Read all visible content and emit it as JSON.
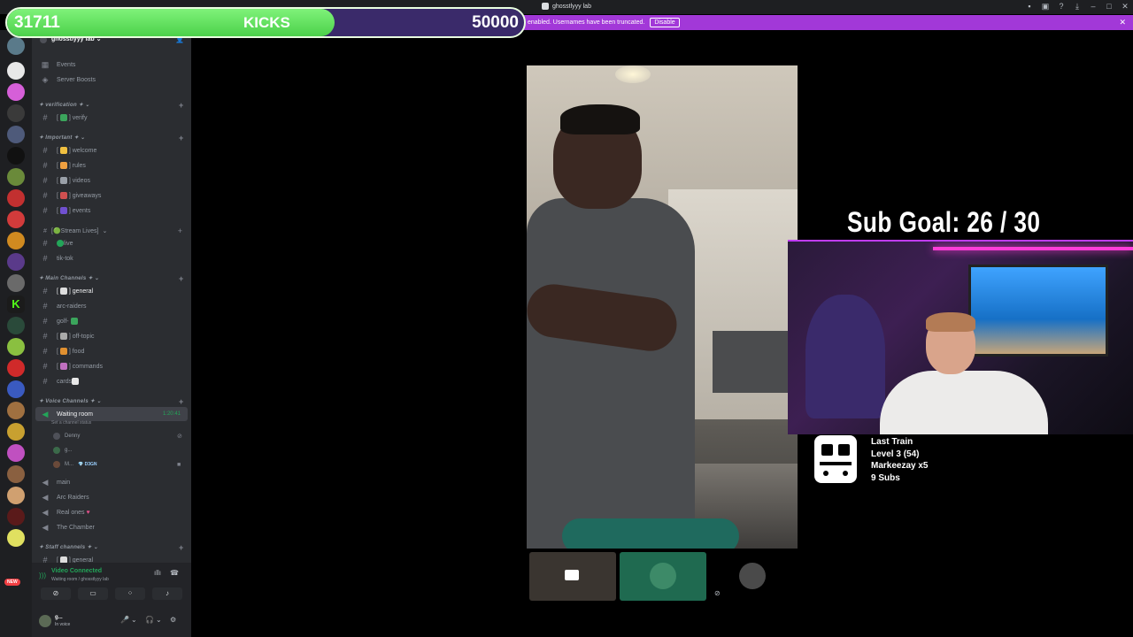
{
  "window": {
    "title": "ghosstlyyy lab"
  },
  "notice": {
    "text": "enabled. Usernames have been truncated.",
    "button": "Disable",
    "close": "✕"
  },
  "kicks": {
    "current": "31711",
    "label": "KICKS",
    "goal": "50000",
    "progress": 0.634
  },
  "server": {
    "name": "ghosstlyyy lab"
  },
  "menu": {
    "events": "Events",
    "boosts": "Server Boosts"
  },
  "categories": {
    "verification": "✦ verification ✦",
    "important": "✦ Important ✦",
    "stream": "[🟢Stream Lives]",
    "main": "✦ Main Channels ✦",
    "voice": "✦ Voice Channels ✦",
    "staff": "✦ Staff channels ✦"
  },
  "channels": {
    "verify": "verify",
    "welcome": "welcome",
    "rules": "rules",
    "videos": "videos",
    "giveaways": "giveaways",
    "events": "events",
    "live": "live",
    "tiktok": "tik-tok",
    "general": "general",
    "arc": "arc-raiders",
    "golf": "golf-",
    "offtopic": "off-topic",
    "food": "food",
    "commands": "commands",
    "cards": "cards",
    "staff_general": "general"
  },
  "voice": {
    "waiting": "Waiting room",
    "waiting_status": "Set a channel status",
    "waiting_time": "1:20:41",
    "users": [
      "Denny",
      "g...",
      "M..."
    ],
    "badge": "D3GN",
    "main": "main",
    "arc": "Arc Raiders",
    "realones": "Real ones",
    "chamber": "The Chamber"
  },
  "connection": {
    "title": "Video Connected",
    "sub": "Waiting room / ghosstlyyy lab"
  },
  "user": {
    "name": "g...",
    "state": "In voice"
  },
  "overlay": {
    "subgoal": "Sub Goal:  26 / 30",
    "train": [
      "Last Train",
      "Level 3  (54)",
      "Markeezay x5",
      "9 Subs"
    ]
  },
  "colors": {
    "accent": "#a238d8",
    "kick_green": "#53fc18",
    "online": "#23a559"
  }
}
